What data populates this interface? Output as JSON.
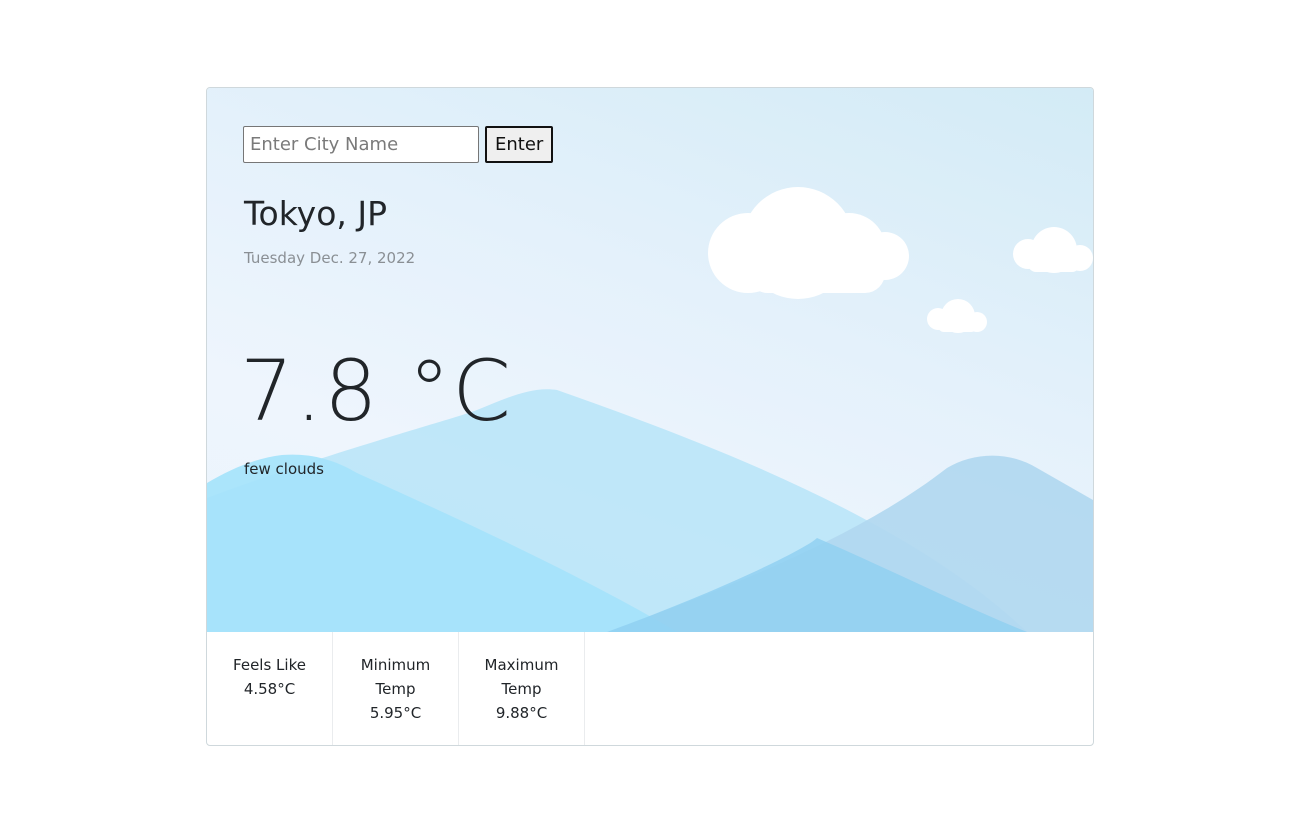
{
  "search": {
    "placeholder": "Enter City Name",
    "value": "",
    "button_label": "Enter"
  },
  "weather": {
    "location": "Tokyo, JP",
    "date": "Tuesday Dec. 27, 2022",
    "temperature": "7.8 °C",
    "description": "few clouds"
  },
  "stats": [
    {
      "label": "Feels Like",
      "value": "4.58°C"
    },
    {
      "label": "Minimum Temp",
      "value": "5.95°C"
    },
    {
      "label": "Maximum Temp",
      "value": "9.88°C"
    }
  ],
  "colors": {
    "sky_light": "#eef5fd",
    "sky_tint": "#d3ebf6",
    "mountain_front": "#a5e3fb",
    "mountain_back": "#bde6f9",
    "mountain_right": "#b1d8f0",
    "cloud": "#ffffff"
  },
  "icons": [
    "cloud-large",
    "cloud-small",
    "cloud-tiny",
    "mountains"
  ]
}
